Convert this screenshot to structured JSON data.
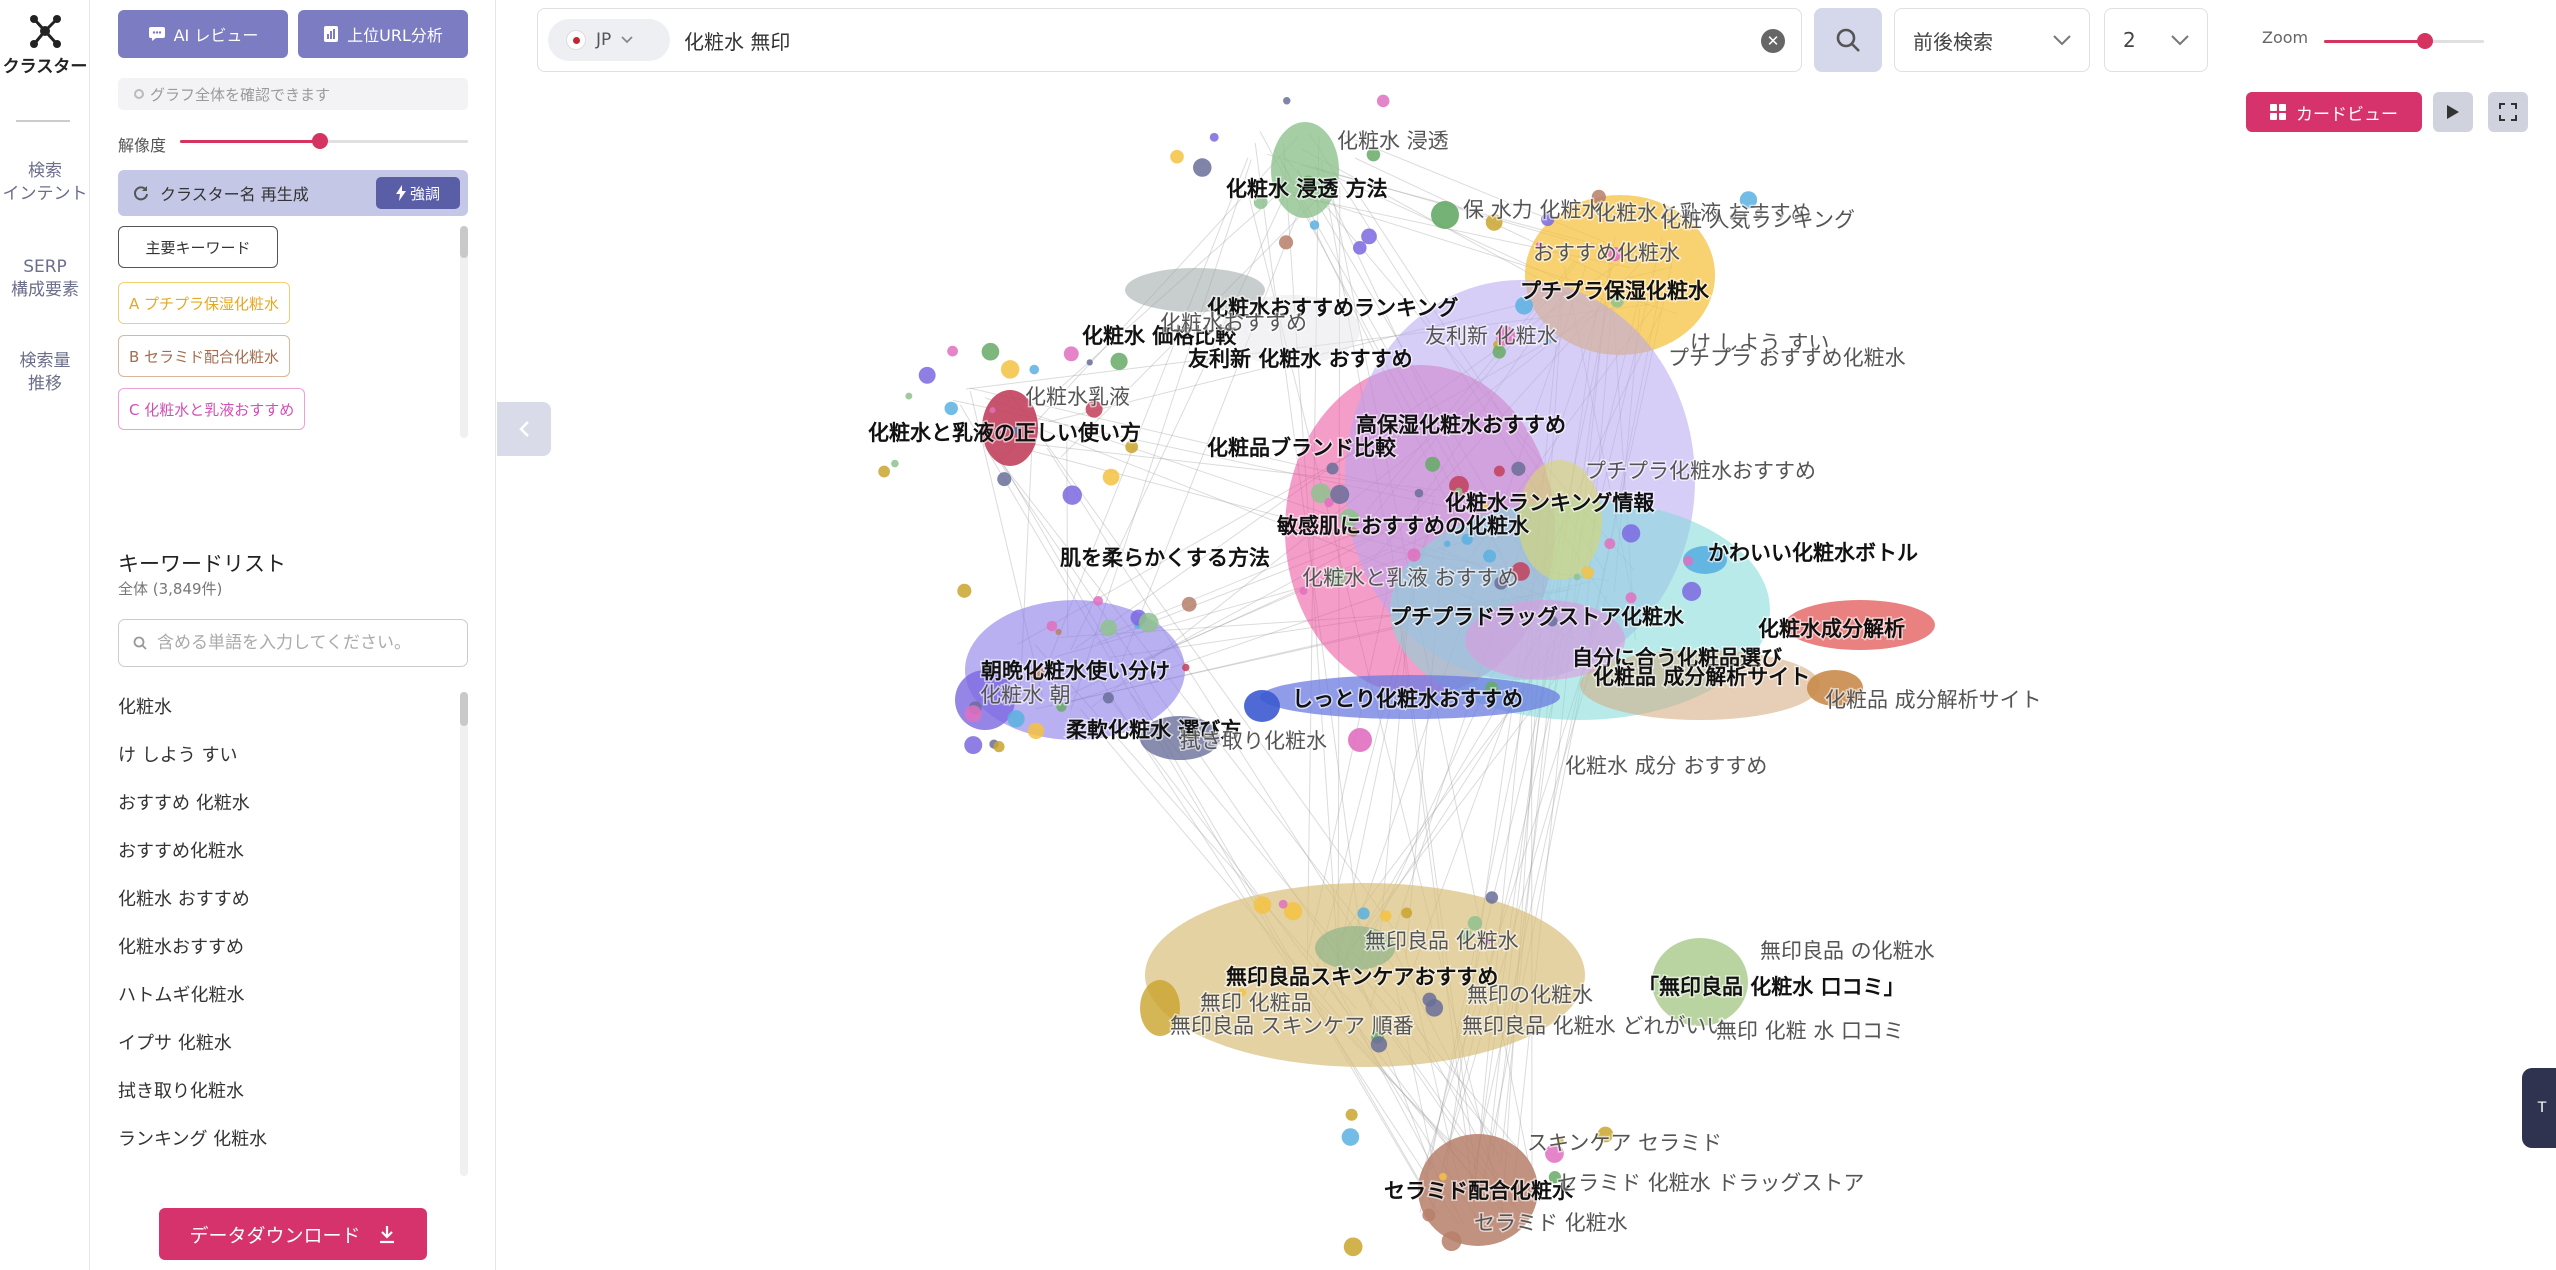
{
  "rail": {
    "logo_label": "クラスター",
    "items": [
      "検索\nインテント",
      "SERP\n構成要素",
      "検索量\n推移"
    ]
  },
  "sidebar": {
    "ai_review": "AI レビュー",
    "url_analysis": "上位URL分析",
    "hint": "グラフ全体を確認できます",
    "resolution_label": "解像度",
    "resolution_value": 0.49,
    "cluster_regen": "クラスター名 再生成",
    "strong_label": "強調",
    "main_keyword": "主要キーワード",
    "chips": [
      "A プチプラ保湿化粧水",
      "B セラミド配合化粧水",
      "C 化粧水と乳液おすすめ"
    ],
    "kw_title": "キーワードリスト",
    "kw_count": "全体 (3,849件)",
    "kw_search_placeholder": "含める単語を入力してください。",
    "keywords": [
      "化粧水",
      "け しよう すい",
      "おすすめ 化粧水",
      "おすすめ化粧水",
      "化粧水 おすすめ",
      "化粧水おすすめ",
      "ハトムギ化粧水",
      "イプサ 化粧水",
      "拭き取り化粧水",
      "ランキング 化粧水"
    ],
    "download": "データダウンロード"
  },
  "topbar": {
    "country": "JP",
    "query": "化粧水 無印",
    "mode": "前後検索",
    "depth": "2",
    "zoom_label": "Zoom",
    "zoom_value": 0.5
  },
  "view": {
    "card_view": "カードビュー",
    "right_tab": "T"
  },
  "colors": {
    "accent": "#d6336c",
    "purple_btn": "#7c7cc2"
  },
  "graph": {
    "clusters": [
      {
        "name": "yellow-top",
        "color": "#f5c242",
        "opacity": 0.75
      },
      {
        "name": "pink-center",
        "color": "#ea4c9a",
        "opacity": 0.55
      },
      {
        "name": "lavender",
        "color": "#b6a6f0",
        "opacity": 0.55
      },
      {
        "name": "cyan",
        "color": "#7fd8d8",
        "opacity": 0.55
      },
      {
        "name": "olive-bottom",
        "color": "#d8bf7a",
        "opacity": 0.7
      },
      {
        "name": "violet-left",
        "color": "#8b7be8",
        "opacity": 0.6
      },
      {
        "name": "brown-bottom",
        "color": "#b77f6a",
        "opacity": 0.85
      }
    ],
    "labels": [
      {
        "t": "化粧水 浸透",
        "b": false
      },
      {
        "t": "化粧水 浸透 方法",
        "b": true
      },
      {
        "t": "保 水力 化粧水",
        "b": false
      },
      {
        "t": "化粧水と乳液 おすすめ",
        "b": false
      },
      {
        "t": "化粧 人気ランキング",
        "b": false
      },
      {
        "t": "おすすめ化粧水",
        "b": false
      },
      {
        "t": "プチプラ保湿化粧水",
        "b": true
      },
      {
        "t": "化粧水おすすめランキング",
        "b": true
      },
      {
        "t": "化粧水 価格比較",
        "b": true
      },
      {
        "t": "化粧水おすすめ",
        "b": false
      },
      {
        "t": "友利新 化粧水",
        "b": false
      },
      {
        "t": "友利新 化粧水 おすすめ",
        "b": true
      },
      {
        "t": "け しよう すい",
        "b": false
      },
      {
        "t": "プチプラ おすすめ化粧水",
        "b": false
      },
      {
        "t": "化粧水乳液",
        "b": false
      },
      {
        "t": "化粧水と乳液の正しい使い方",
        "b": true
      },
      {
        "t": "高保湿化粧水おすすめ",
        "b": true
      },
      {
        "t": "化粧品ブランド比較",
        "b": true
      },
      {
        "t": "プチプラ化粧水おすすめ",
        "b": false
      },
      {
        "t": "化粧水ランキング情報",
        "b": true
      },
      {
        "t": "敏感肌におすすめの化粧水",
        "b": true
      },
      {
        "t": "肌を柔らかくする方法",
        "b": true
      },
      {
        "t": "かわいい化粧水ボトル",
        "b": true
      },
      {
        "t": "化粧水と乳液 おすすめ",
        "b": false
      },
      {
        "t": "プチプラドラッグストア化粧水",
        "b": true
      },
      {
        "t": "化粧水成分解析",
        "b": true
      },
      {
        "t": "自分に合う化粧品選び",
        "b": true
      },
      {
        "t": "化粧品 成分解析サイト",
        "b": true
      },
      {
        "t": "化粧品 成分解析サイト",
        "b": false
      },
      {
        "t": "朝晩化粧水使い分け",
        "b": true
      },
      {
        "t": "化粧水 朝",
        "b": false
      },
      {
        "t": "しっとり化粧水おすすめ",
        "b": true
      },
      {
        "t": "柔軟化粧水 選び方",
        "b": true
      },
      {
        "t": "拭き取り化粧水",
        "b": false
      },
      {
        "t": "化粧水 成分 おすすめ",
        "b": false
      },
      {
        "t": "無印良品 化粧水",
        "b": false
      },
      {
        "t": "無印良品 の化粧水",
        "b": false
      },
      {
        "t": "無印良品スキンケアおすすめ",
        "b": true
      },
      {
        "t": "無印 化粧品",
        "b": false
      },
      {
        "t": "無印の化粧水",
        "b": false
      },
      {
        "t": "「無印良品 化粧水 口コミ」",
        "b": true
      },
      {
        "t": "無印良品 スキンケア 順番",
        "b": false
      },
      {
        "t": "無印良品 化粧水 どれがいい",
        "b": false
      },
      {
        "t": "無印 化粧 水 口コミ",
        "b": false
      },
      {
        "t": "スキンケア セラミド",
        "b": false
      },
      {
        "t": "セラミド配合化粧水",
        "b": true
      },
      {
        "t": "セラミド 化粧水 ドラッグストア",
        "b": false
      },
      {
        "t": "セラミド 化粧水",
        "b": false
      }
    ]
  }
}
